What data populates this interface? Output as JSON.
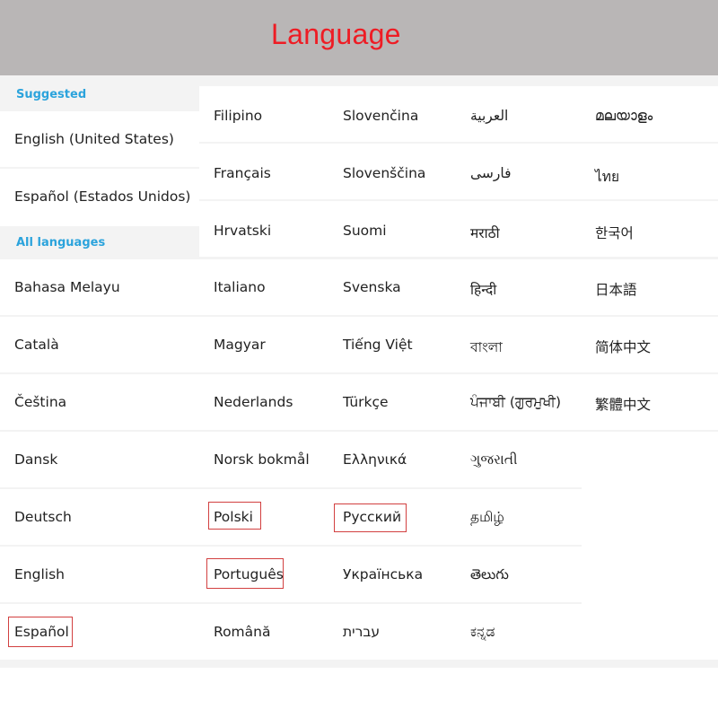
{
  "header": {
    "title": "Language"
  },
  "sections": {
    "suggested": "Suggested",
    "all_languages": "All languages"
  },
  "columns": [
    [
      "English (United States)",
      "Español (Estados Unidos)",
      "Bahasa Melayu",
      "Català",
      "Čeština",
      "Dansk",
      "Deutsch",
      "English",
      "Español"
    ],
    [
      "Filipino",
      "Français",
      "Hrvatski",
      "Italiano",
      "Magyar",
      "Nederlands",
      "Norsk bokmål",
      "Polski",
      "Português",
      "Română"
    ],
    [
      "Slovenčina",
      "Slovenščina",
      "Suomi",
      "Svenska",
      "Tiếng Việt",
      "Türkçe",
      "Ελληνικά",
      "Русский",
      "Українська",
      "עברית"
    ],
    [
      "العربية",
      "فارسی",
      "मराठी",
      "हिन्दी",
      "বাংলা",
      "ਪੰਜਾਬੀ (ਗੁਰਮੁਖੀ)",
      "ગુજરાતી",
      "தமிழ்",
      "తెలుగు",
      "ಕನ್ನಡ"
    ],
    [
      "മലയാളം",
      "ไทย",
      "한국어",
      "日本語",
      "简体中文",
      "繁體中文"
    ]
  ],
  "highlighted": [
    "Español",
    "Polski",
    "Português",
    "Русский"
  ],
  "colors": {
    "header_bg": "#b9b6b6",
    "title": "#ee1c24",
    "section_header": "#2ba3dc",
    "highlight_box": "#d24040"
  }
}
